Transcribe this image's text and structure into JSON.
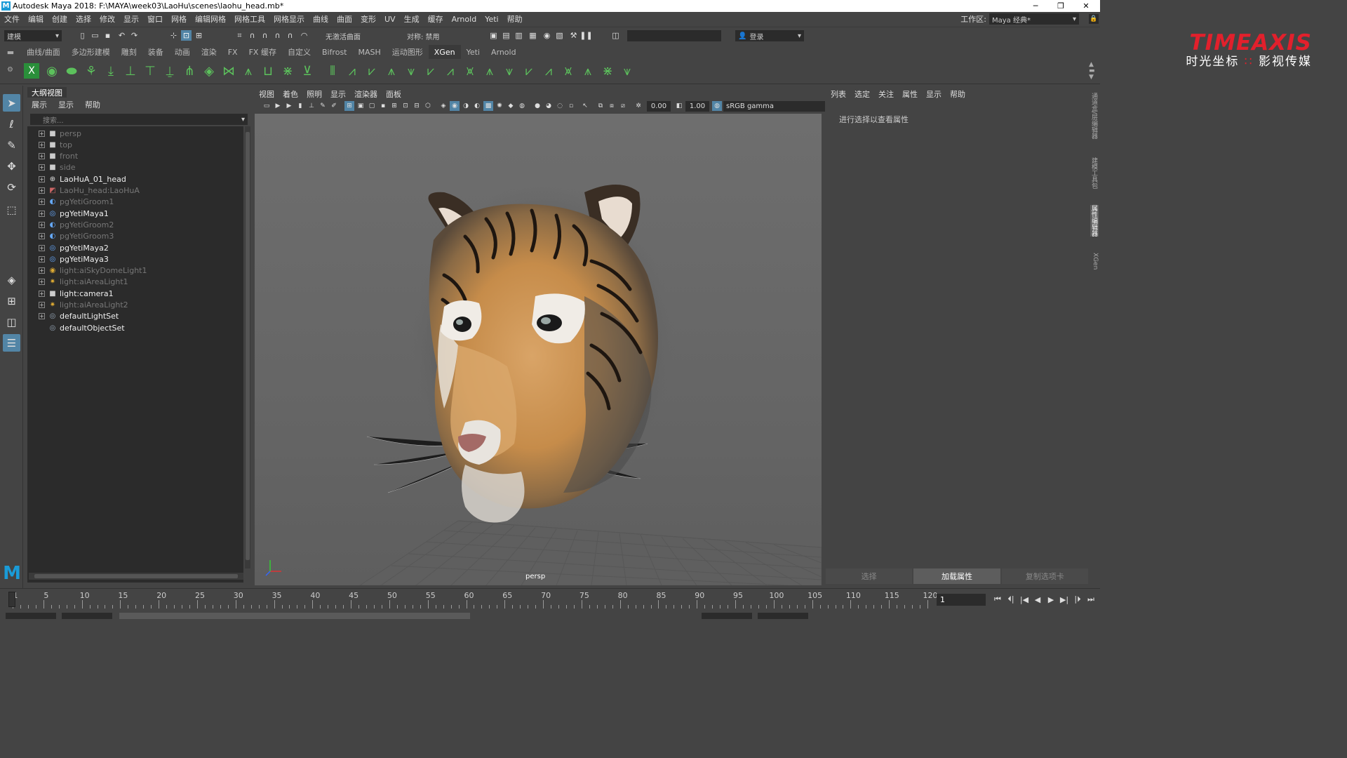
{
  "window": {
    "title": "Autodesk Maya 2018: F:\\MAYA\\week03\\LaoHu\\scenes\\laohu_head.mb*",
    "controls": [
      "─",
      "❐",
      "✕"
    ]
  },
  "menubar": {
    "items": [
      "文件",
      "编辑",
      "创建",
      "选择",
      "修改",
      "显示",
      "窗口",
      "网格",
      "编辑网格",
      "网格工具",
      "网格显示",
      "曲线",
      "曲面",
      "变形",
      "UV",
      "生成",
      "缓存",
      "Arnold",
      "Yeti",
      "帮助"
    ],
    "workspace_label": "工作区:",
    "workspace_value": "Maya 经典*"
  },
  "statusline": {
    "mode": "建模",
    "surface": "无激活曲面",
    "symmetry": "对称: 禁用",
    "login": "登录"
  },
  "shelf_tabs": [
    "曲线/曲面",
    "多边形建模",
    "雕刻",
    "装备",
    "动画",
    "渲染",
    "FX",
    "FX 缓存",
    "自定义",
    "Bifrost",
    "MASH",
    "运动图形",
    "XGen",
    "Yeti",
    "Arnold"
  ],
  "shelf_active": "XGen",
  "brand": {
    "logo": "TIMEAXIS",
    "sub_left": "时光坐标",
    "sub_dot": "∷",
    "sub_right": "影视传媒"
  },
  "outliner": {
    "panel_title": "大纲视图",
    "menu": [
      "展示",
      "显示",
      "帮助"
    ],
    "search_placeholder": "搜索...",
    "items": [
      {
        "label": "persp",
        "icon": "camera-icon",
        "dim": true,
        "expand": true
      },
      {
        "label": "top",
        "icon": "camera-icon",
        "dim": true,
        "expand": true
      },
      {
        "label": "front",
        "icon": "camera-icon",
        "dim": true,
        "expand": true
      },
      {
        "label": "side",
        "icon": "camera-icon",
        "dim": true,
        "expand": true
      },
      {
        "label": "LaoHuA_01_head",
        "icon": "transform-icon",
        "dim": false,
        "expand": true
      },
      {
        "label": "LaoHu_head:LaoHuA",
        "icon": "mesh-icon",
        "dim": true,
        "expand": true
      },
      {
        "label": "pgYetiGroom1",
        "icon": "yeti-groom-icon",
        "dim": true,
        "expand": true
      },
      {
        "label": "pgYetiMaya1",
        "icon": "yeti-node-icon",
        "dim": false,
        "expand": true
      },
      {
        "label": "pgYetiGroom2",
        "icon": "yeti-groom-icon",
        "dim": true,
        "expand": true
      },
      {
        "label": "pgYetiGroom3",
        "icon": "yeti-groom-icon",
        "dim": true,
        "expand": true
      },
      {
        "label": "pgYetiMaya2",
        "icon": "yeti-node-icon",
        "dim": false,
        "expand": true
      },
      {
        "label": "pgYetiMaya3",
        "icon": "yeti-node-icon",
        "dim": false,
        "expand": true
      },
      {
        "label": "light:aiSkyDomeLight1",
        "icon": "skydome-icon",
        "dim": true,
        "expand": true
      },
      {
        "label": "light:aiAreaLight1",
        "icon": "light-icon",
        "dim": true,
        "expand": true
      },
      {
        "label": "light:camera1",
        "icon": "camera-icon",
        "dim": false,
        "expand": true
      },
      {
        "label": "light:aiAreaLight2",
        "icon": "light-icon",
        "dim": true,
        "expand": true
      },
      {
        "label": "defaultLightSet",
        "icon": "set-icon",
        "dim": false,
        "expand": true
      },
      {
        "label": "defaultObjectSet",
        "icon": "set-icon",
        "dim": false,
        "expand": false
      }
    ]
  },
  "viewport": {
    "menu": [
      "视图",
      "着色",
      "照明",
      "显示",
      "渲染器",
      "面板"
    ],
    "exposure": "0.00",
    "gamma": "1.00",
    "colorspace": "sRGB gamma",
    "camera": "persp"
  },
  "attribute_editor": {
    "menu": [
      "列表",
      "选定",
      "关注",
      "属性",
      "显示",
      "帮助"
    ],
    "message": "进行选择以查看属性",
    "buttons": [
      "选择",
      "加载属性",
      "复制选项卡"
    ],
    "active_button": "加载属性"
  },
  "side_tabs": [
    "通道盒/层编辑器",
    "建模工具包",
    "属性编辑器",
    "XGen"
  ],
  "timeline": {
    "ticks": [
      "1",
      "5",
      "10",
      "15",
      "20",
      "25",
      "30",
      "35",
      "40",
      "45",
      "50",
      "55",
      "60",
      "65",
      "70",
      "75",
      "80",
      "85",
      "90",
      "95",
      "100",
      "105",
      "110",
      "115",
      "120"
    ],
    "current_frame": "1"
  }
}
